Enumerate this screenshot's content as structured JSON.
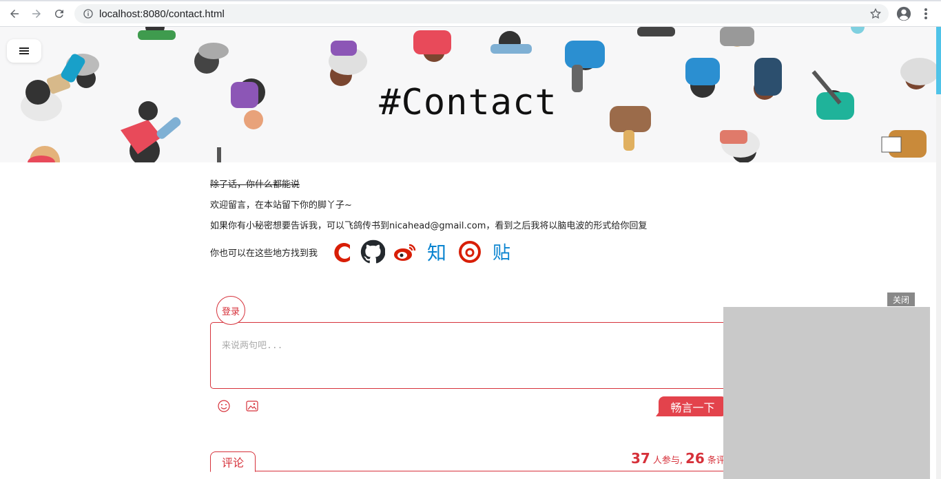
{
  "browser": {
    "url": "localhost:8080/contact.html",
    "back_icon": "arrow-left-icon",
    "forward_icon": "arrow-right-icon",
    "reload_icon": "reload-icon"
  },
  "hero": {
    "title": "#Contact",
    "menu_icon": "hamburger-icon"
  },
  "content": {
    "line1": "除了话，你什么都能说",
    "line2": "欢迎留言，在本站留下你的脚丫子~",
    "line3": "如果你有小秘密想要告诉我，可以飞鸽传书到nicahead@gmail.com，看到之后我将以脑电波的形式给你回复",
    "find_me_label": "你也可以在这些地方找到我",
    "social": [
      {
        "name": "csdn",
        "glyph": "C",
        "color": "#d81e06"
      },
      {
        "name": "github",
        "glyph": "",
        "color": "#24292e"
      },
      {
        "name": "weibo",
        "glyph": "",
        "color": "#d81e06"
      },
      {
        "name": "zhihu",
        "glyph": "知",
        "color": "#0a84d0"
      },
      {
        "name": "netease-music",
        "glyph": "",
        "color": "#d81e06"
      },
      {
        "name": "tieba",
        "glyph": "贴",
        "color": "#0a84d0"
      }
    ]
  },
  "comment": {
    "login_label": "登录",
    "placeholder": "来说两句吧...",
    "submit_label": "畅言一下",
    "tab_label": "评论",
    "participants": "37",
    "participants_suffix": "人参与,",
    "comments_count": "26",
    "comments_suffix": "条评论"
  },
  "ad": {
    "close_label": "关闭"
  },
  "colors": {
    "accent": "#d6313a",
    "submit": "#e3434c",
    "scroll_thumb": "#4fc3e8"
  }
}
